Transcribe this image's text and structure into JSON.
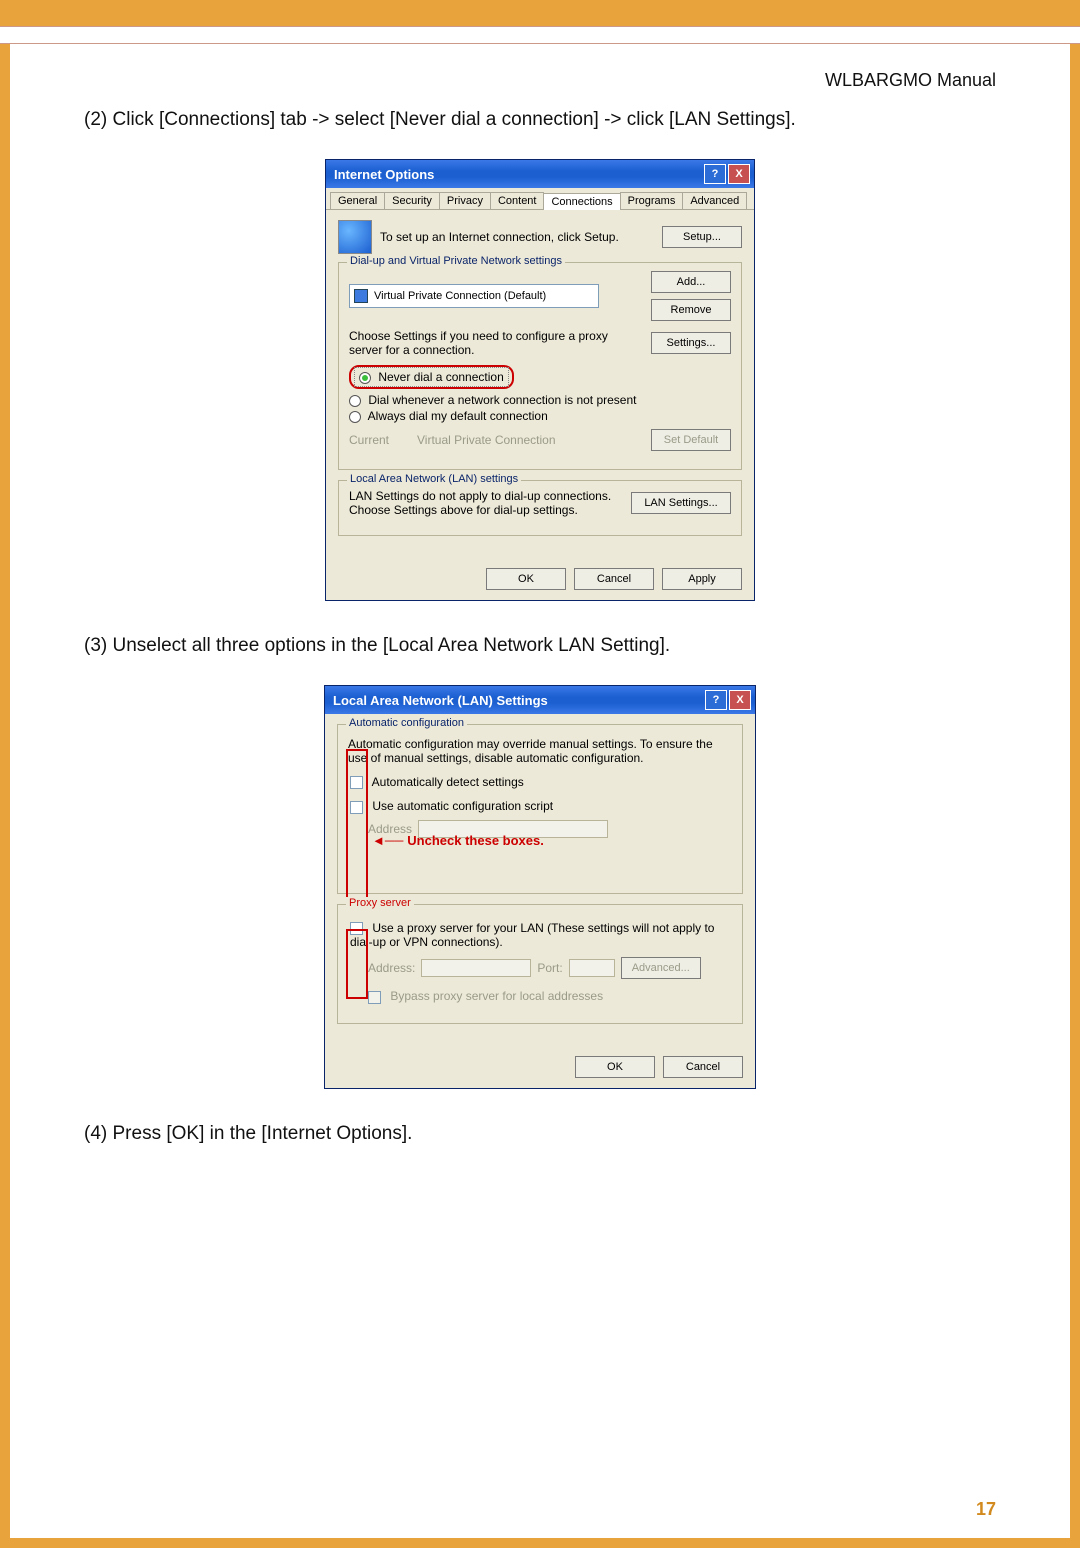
{
  "doc": {
    "header_title": "WLBARGMO Manual",
    "page_number": "17"
  },
  "steps": {
    "s2": "(2) Click [Connections] tab -> select [Never dial a connection] -> click [LAN Settings].",
    "s3": "(3) Unselect all three options in the  [Local Area Network LAN Setting].",
    "s4": "(4) Press [OK] in the [Internet Options]."
  },
  "dialog1": {
    "title": "Internet Options",
    "tabs": [
      "General",
      "Security",
      "Privacy",
      "Content",
      "Connections",
      "Programs",
      "Advanced"
    ],
    "active_tab_index": 4,
    "setup_text": "To set up an Internet connection, click Setup.",
    "btn_setup": "Setup...",
    "group_dialup": "Dial-up and Virtual Private Network settings",
    "list_item": "Virtual Private Connection (Default)",
    "btn_add": "Add...",
    "btn_remove": "Remove",
    "choose_text": "Choose Settings if you need to configure a proxy server for a connection.",
    "btn_settings": "Settings...",
    "radio_never": "Never dial a connection",
    "radio_whenever": "Dial whenever a network connection is not present",
    "radio_always": "Always dial my default connection",
    "current_label": "Current",
    "current_value": "Virtual Private Connection",
    "btn_setdefault": "Set Default",
    "group_lan": "Local Area Network (LAN) settings",
    "lan_text": "LAN Settings do not apply to dial-up connections. Choose Settings above for dial-up settings.",
    "btn_lan": "LAN Settings...",
    "btn_ok": "OK",
    "btn_cancel": "Cancel",
    "btn_apply": "Apply"
  },
  "dialog2": {
    "title": "Local Area Network (LAN) Settings",
    "group_auto": "Automatic configuration",
    "auto_text": "Automatic configuration may override manual settings.  To ensure the use of manual settings, disable automatic configuration.",
    "chk_detect": "Automatically detect settings",
    "chk_script": "Use automatic configuration script",
    "address_label": "Address",
    "annotation": "Uncheck these boxes.",
    "group_proxy": "Proxy server",
    "chk_proxy": "Use a proxy server for your LAN (These settings will not apply to dial-up or VPN connections).",
    "addr2_label": "Address:",
    "port_label": "Port:",
    "btn_adv": "Advanced...",
    "chk_bypass": "Bypass proxy server for local addresses",
    "btn_ok": "OK",
    "btn_cancel": "Cancel"
  }
}
